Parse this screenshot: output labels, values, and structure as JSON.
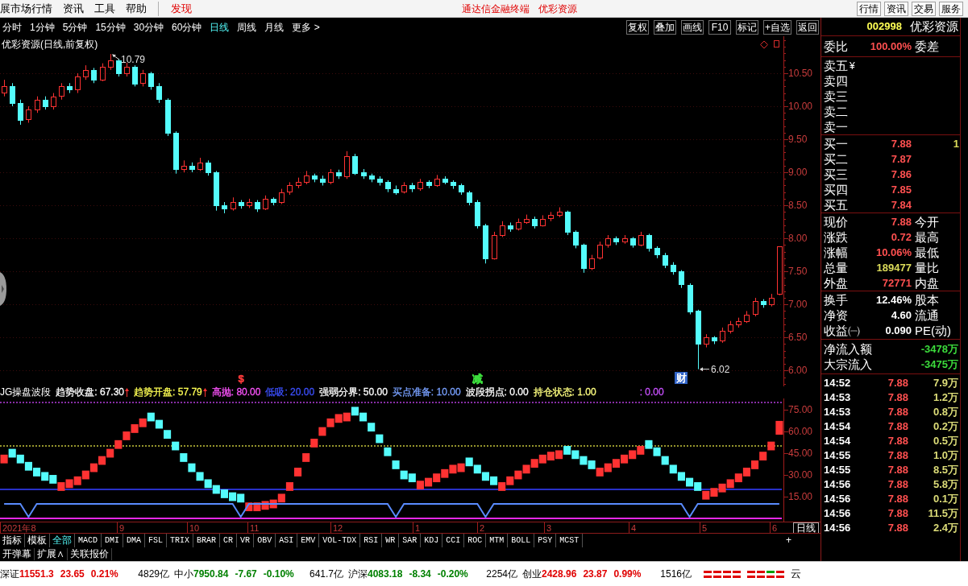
{
  "menu_bar": {
    "items": [
      {
        "label": "展市场行情",
        "kind": "menu"
      },
      {
        "label": "资讯",
        "kind": "menu"
      },
      {
        "label": "工具",
        "kind": "menu"
      },
      {
        "label": "帮助",
        "kind": "menu"
      },
      {
        "label": "发现",
        "kind": "highlight"
      }
    ],
    "title": "通达信金融终端",
    "subtitle": "优彩资源",
    "buttons": [
      "行情",
      "资讯",
      "交易",
      "服务"
    ]
  },
  "toolbar": {
    "periods": [
      {
        "label": "分时",
        "selected": false
      },
      {
        "label": "1分钟",
        "selected": false
      },
      {
        "label": "5分钟",
        "selected": false
      },
      {
        "label": "15分钟",
        "selected": false
      },
      {
        "label": "30分钟",
        "selected": false
      },
      {
        "label": "60分钟",
        "selected": false
      },
      {
        "label": "日线",
        "selected": true
      },
      {
        "label": "周线",
        "selected": false
      },
      {
        "label": "月线",
        "selected": false
      },
      {
        "label": "更多 >",
        "selected": false
      }
    ],
    "buttons": [
      "复权",
      "叠加",
      "画线",
      "F10",
      "标记",
      "+自选",
      "返回"
    ]
  },
  "price_chart": {
    "chart_data": [
      {
        "type": "candlestick",
        "title": "优彩资源(日线,前复权)",
        "ylim": [
          5.76,
          11.06
        ],
        "yticks": [
          {
            "value": 6,
            "label": "6.00"
          },
          {
            "value": 6.5,
            "label": "6.50"
          },
          {
            "value": 7,
            "label": "7.00"
          },
          {
            "value": 7.5,
            "label": "7.50"
          },
          {
            "value": 8,
            "label": "8.00"
          },
          {
            "value": 8.5,
            "label": "8.50"
          },
          {
            "value": 9,
            "label": "9.00"
          },
          {
            "value": 9.5,
            "label": "9.50"
          },
          {
            "value": 10,
            "label": "10.00"
          },
          {
            "value": 10.5,
            "label": "10.50"
          }
        ],
        "grid": true,
        "annotations": [
          "10.79",
          "6.02"
        ],
        "ohlc": [
          [
            10.2,
            10.4,
            10.15,
            10.3
          ],
          [
            10.3,
            10.35,
            10.0,
            10.05
          ],
          [
            10.05,
            10.1,
            9.72,
            9.8
          ],
          [
            9.8,
            10.0,
            9.75,
            9.95
          ],
          [
            9.95,
            10.15,
            9.9,
            10.1
          ],
          [
            10.1,
            10.15,
            9.95,
            10.0
          ],
          [
            10.0,
            10.2,
            9.95,
            10.15
          ],
          [
            10.15,
            10.35,
            10.1,
            10.3
          ],
          [
            10.3,
            10.35,
            10.2,
            10.25
          ],
          [
            10.25,
            10.5,
            10.2,
            10.45
          ],
          [
            10.45,
            10.62,
            10.4,
            10.55
          ],
          [
            10.55,
            10.58,
            10.35,
            10.4
          ],
          [
            10.4,
            10.65,
            10.38,
            10.6
          ],
          [
            10.6,
            10.79,
            10.55,
            10.7
          ],
          [
            10.7,
            10.72,
            10.45,
            10.5
          ],
          [
            10.5,
            10.66,
            10.45,
            10.6
          ],
          [
            10.6,
            10.62,
            10.3,
            10.35
          ],
          [
            10.35,
            10.55,
            10.3,
            10.5
          ],
          [
            10.5,
            10.52,
            10.25,
            10.3
          ],
          [
            10.3,
            10.35,
            10.05,
            10.1
          ],
          [
            10.1,
            10.12,
            9.55,
            9.6
          ],
          [
            9.6,
            9.62,
            8.98,
            9.05
          ],
          [
            9.05,
            9.18,
            9.0,
            9.1
          ],
          [
            9.1,
            9.15,
            9.0,
            9.05
          ],
          [
            9.05,
            9.22,
            9.02,
            9.15
          ],
          [
            9.15,
            9.18,
            8.95,
            9.0
          ],
          [
            9.0,
            9.02,
            8.42,
            8.5
          ],
          [
            8.5,
            8.55,
            8.38,
            8.45
          ],
          [
            8.45,
            8.62,
            8.42,
            8.55
          ],
          [
            8.55,
            8.58,
            8.45,
            8.5
          ],
          [
            8.5,
            8.6,
            8.46,
            8.55
          ],
          [
            8.55,
            8.58,
            8.4,
            8.45
          ],
          [
            8.45,
            8.65,
            8.43,
            8.6
          ],
          [
            8.6,
            8.62,
            8.5,
            8.55
          ],
          [
            8.55,
            8.75,
            8.52,
            8.7
          ],
          [
            8.7,
            8.85,
            8.66,
            8.8
          ],
          [
            8.8,
            8.92,
            8.76,
            8.85
          ],
          [
            8.85,
            9.02,
            8.82,
            8.95
          ],
          [
            8.95,
            8.98,
            8.85,
            8.9
          ],
          [
            8.9,
            8.95,
            8.8,
            8.85
          ],
          [
            8.85,
            9.05,
            8.82,
            9.0
          ],
          [
            9.0,
            9.04,
            8.9,
            8.95
          ],
          [
            8.95,
            9.32,
            8.9,
            9.25
          ],
          [
            9.25,
            9.28,
            8.96,
            9.0
          ],
          [
            9.0,
            9.05,
            8.9,
            8.95
          ],
          [
            8.95,
            8.98,
            8.85,
            8.9
          ],
          [
            8.9,
            8.94,
            8.8,
            8.85
          ],
          [
            8.85,
            8.88,
            8.7,
            8.75
          ],
          [
            8.75,
            8.8,
            8.66,
            8.7
          ],
          [
            8.7,
            8.85,
            8.68,
            8.8
          ],
          [
            8.8,
            8.84,
            8.7,
            8.75
          ],
          [
            8.75,
            8.9,
            8.72,
            8.85
          ],
          [
            8.85,
            8.88,
            8.76,
            8.8
          ],
          [
            8.8,
            8.96,
            8.78,
            8.9
          ],
          [
            8.9,
            8.94,
            8.82,
            8.85
          ],
          [
            8.85,
            8.88,
            8.75,
            8.8
          ],
          [
            8.8,
            8.83,
            8.66,
            8.7
          ],
          [
            8.7,
            8.72,
            8.5,
            8.55
          ],
          [
            8.55,
            8.58,
            8.15,
            8.2
          ],
          [
            8.2,
            8.22,
            7.62,
            7.7
          ],
          [
            7.7,
            8.1,
            7.68,
            8.05
          ],
          [
            8.05,
            8.26,
            8.02,
            8.2
          ],
          [
            8.2,
            8.24,
            8.1,
            8.15
          ],
          [
            8.15,
            8.3,
            8.12,
            8.25
          ],
          [
            8.25,
            8.36,
            8.22,
            8.3
          ],
          [
            8.3,
            8.33,
            8.15,
            8.2
          ],
          [
            8.2,
            8.35,
            8.18,
            8.3
          ],
          [
            8.3,
            8.4,
            8.26,
            8.35
          ],
          [
            8.35,
            8.47,
            8.32,
            8.4
          ],
          [
            8.4,
            8.42,
            8.05,
            8.1
          ],
          [
            8.1,
            8.12,
            7.85,
            7.9
          ],
          [
            7.9,
            7.92,
            7.48,
            7.55
          ],
          [
            7.55,
            7.75,
            7.52,
            7.7
          ],
          [
            7.7,
            7.95,
            7.68,
            7.9
          ],
          [
            7.9,
            8.05,
            7.86,
            8.0
          ],
          [
            8.0,
            8.03,
            7.9,
            7.95
          ],
          [
            7.95,
            8.05,
            7.92,
            8.0
          ],
          [
            8.0,
            8.02,
            7.86,
            7.9
          ],
          [
            7.9,
            8.1,
            7.88,
            8.05
          ],
          [
            8.05,
            8.07,
            7.8,
            7.85
          ],
          [
            7.85,
            7.88,
            7.7,
            7.75
          ],
          [
            7.75,
            7.78,
            7.55,
            7.6
          ],
          [
            7.6,
            7.64,
            7.45,
            7.5
          ],
          [
            7.5,
            7.52,
            7.25,
            7.3
          ],
          [
            7.3,
            7.32,
            6.85,
            6.9
          ],
          [
            6.9,
            6.92,
            6.02,
            6.4
          ],
          [
            6.4,
            6.55,
            6.35,
            6.5
          ],
          [
            6.5,
            6.52,
            6.4,
            6.45
          ],
          [
            6.45,
            6.65,
            6.42,
            6.6
          ],
          [
            6.6,
            6.75,
            6.56,
            6.7
          ],
          [
            6.7,
            6.8,
            6.65,
            6.75
          ],
          [
            6.75,
            6.9,
            6.72,
            6.85
          ],
          [
            6.85,
            7.1,
            6.82,
            7.05
          ],
          [
            7.05,
            7.08,
            6.95,
            7.0
          ],
          [
            7.0,
            7.16,
            6.97,
            7.1
          ],
          [
            7.16,
            7.88,
            7.14,
            7.88
          ]
        ]
      }
    ],
    "markers": [
      {
        "text": "$",
        "color": "#ff3c3c",
        "boxed": false
      },
      {
        "text": "减",
        "color": "#3cdc3c",
        "boxed": false
      },
      {
        "text": "财",
        "color": "#3264c8",
        "boxed": true
      }
    ]
  },
  "indicator": {
    "name": "JG操盘波段",
    "legend": [
      {
        "text": "趋势收盘: 67.30",
        "color": "#ffffff",
        "rising": true
      },
      {
        "text": "趋势开盘: 57.79",
        "color": "#ffff54",
        "rising": true
      },
      {
        "text": "高抛: 80.00",
        "color": "#ff54ff",
        "rising": false
      },
      {
        "text": "低吸: 20.00",
        "color": "#3c50ff",
        "rising": false
      },
      {
        "text": "强弱分界: 50.00",
        "color": "#ffffff",
        "rising": false
      },
      {
        "text": "买点准备: 10.00",
        "color": "#78a0ff",
        "rising": false
      },
      {
        "text": "波段拐点: 0.00",
        "color": "#ffffff",
        "rising": false
      },
      {
        "text": "持仓状态: 1.00",
        "color": "#ffff80",
        "rising": false
      },
      {
        "text": ": 0.00",
        "color": "#c850ff",
        "rising": false
      }
    ],
    "chart_data": [
      {
        "type": "bar",
        "ylim": [
          -2.2,
          82.8
        ],
        "yticks": [
          {
            "value": 15,
            "label": "15.00"
          },
          {
            "value": 30,
            "label": "30.00"
          },
          {
            "value": 45,
            "label": "45.00"
          },
          {
            "value": 60,
            "label": "60.00"
          },
          {
            "value": 75,
            "label": "75.00"
          }
        ],
        "base": [
          38,
          48,
          44,
          39,
          35,
          32,
          30,
          19,
          21,
          23,
          27,
          32,
          37,
          42,
          48,
          54,
          59,
          63,
          73,
          68,
          61,
          53,
          45,
          38,
          32,
          27,
          23,
          20,
          18,
          17,
          5,
          5,
          6,
          7,
          11,
          19,
          29,
          39,
          49,
          57,
          63,
          66,
          67,
          77,
          73,
          66,
          58,
          49,
          40,
          33,
          31,
          20,
          22,
          25,
          28,
          31,
          32,
          42,
          37,
          32,
          29,
          19,
          23,
          27,
          31,
          35,
          38,
          40,
          41,
          50,
          47,
          43,
          40,
          29,
          32,
          35,
          38,
          41,
          44,
          54,
          49,
          43,
          37,
          32,
          28,
          25,
          13,
          15,
          18,
          21,
          25,
          29,
          34,
          40,
          47,
          57.8
        ],
        "values": [
          6,
          -6,
          -6,
          -6,
          -6,
          -6,
          -6,
          6,
          6,
          6,
          6,
          6,
          6,
          6,
          6,
          6,
          6,
          6,
          -6,
          -6,
          -6,
          -6,
          -6,
          -6,
          -6,
          -6,
          -6,
          -6,
          -6,
          -6,
          6,
          6,
          6,
          6,
          6,
          6,
          6,
          6,
          6,
          6,
          6,
          6,
          6,
          -6,
          -6,
          -6,
          -6,
          -6,
          -6,
          -6,
          -6,
          6,
          6,
          6,
          6,
          6,
          6,
          -6,
          -6,
          -6,
          -6,
          6,
          6,
          6,
          6,
          6,
          6,
          6,
          6,
          -6,
          -6,
          -6,
          -6,
          6,
          6,
          6,
          6,
          6,
          6,
          -6,
          -6,
          -6,
          -6,
          -6,
          -6,
          -6,
          6,
          6,
          6,
          6,
          6,
          6,
          6,
          6,
          6,
          9.5
        ],
        "colors": [
          "#ff3232",
          "#54fcfc",
          "#54fcfc",
          "#54fcfc",
          "#54fcfc",
          "#54fcfc",
          "#54fcfc",
          "#ff3232",
          "#ff3232",
          "#ff3232",
          "#ff3232",
          "#ff3232",
          "#ff3232",
          "#ff3232",
          "#ff3232",
          "#ff3232",
          "#ff3232",
          "#ff3232",
          "#54fcfc",
          "#54fcfc",
          "#54fcfc",
          "#54fcfc",
          "#54fcfc",
          "#54fcfc",
          "#54fcfc",
          "#54fcfc",
          "#54fcfc",
          "#54fcfc",
          "#54fcfc",
          "#54fcfc",
          "#ff3232",
          "#ff3232",
          "#ff3232",
          "#ff3232",
          "#ff3232",
          "#ff3232",
          "#ff3232",
          "#ff3232",
          "#ff3232",
          "#ff3232",
          "#ff3232",
          "#ff3232",
          "#ff3232",
          "#54fcfc",
          "#54fcfc",
          "#54fcfc",
          "#54fcfc",
          "#54fcfc",
          "#54fcfc",
          "#54fcfc",
          "#54fcfc",
          "#ff3232",
          "#ff3232",
          "#ff3232",
          "#ff3232",
          "#ff3232",
          "#ff3232",
          "#54fcfc",
          "#54fcfc",
          "#54fcfc",
          "#54fcfc",
          "#ff3232",
          "#ff3232",
          "#ff3232",
          "#ff3232",
          "#ff3232",
          "#ff3232",
          "#ff3232",
          "#ff3232",
          "#54fcfc",
          "#54fcfc",
          "#54fcfc",
          "#54fcfc",
          "#ff3232",
          "#ff3232",
          "#ff3232",
          "#ff3232",
          "#ff3232",
          "#ff3232",
          "#54fcfc",
          "#54fcfc",
          "#54fcfc",
          "#54fcfc",
          "#54fcfc",
          "#54fcfc",
          "#54fcfc",
          "#ff3232",
          "#ff3232",
          "#ff3232",
          "#ff3232",
          "#ff3232",
          "#ff3232",
          "#ff3232",
          "#ff3232",
          "#ff3232",
          "#ff3232"
        ],
        "series": [
          {
            "type": "line",
            "color": "#5a8cff",
            "values": [
              10,
              10,
              10,
              1,
              10,
              10,
              10,
              10,
              10,
              10,
              10,
              10,
              10,
              10,
              10,
              10,
              10,
              10,
              10,
              10,
              10,
              10,
              10,
              10,
              10,
              10,
              10,
              10,
              10,
              1,
              10,
              10,
              10,
              10,
              10,
              10,
              10,
              10,
              10,
              10,
              10,
              10,
              10,
              10,
              10,
              10,
              10,
              10,
              1,
              10,
              10,
              10,
              10,
              10,
              10,
              10,
              10,
              10,
              10,
              1,
              10,
              10,
              10,
              10,
              10,
              10,
              10,
              10,
              10,
              10,
              10,
              10,
              10,
              10,
              10,
              10,
              10,
              10,
              10,
              10,
              10,
              10,
              10,
              10,
              1,
              10,
              10,
              10,
              10,
              10,
              10,
              10,
              10,
              10,
              10,
              10
            ]
          }
        ],
        "ref_lines": [
          {
            "axis": "y",
            "value": 80,
            "color": "#b43cdc",
            "line_style": "dotted"
          },
          {
            "axis": "y",
            "value": 50,
            "color": "#c8c83c",
            "line_style": "dotted"
          },
          {
            "axis": "y",
            "value": 20,
            "color": "#2830c8",
            "line_style": "solid"
          },
          {
            "axis": "y",
            "value": 0,
            "color": "#e628e6",
            "line_style": "solid"
          }
        ]
      }
    ],
    "time_axis": [
      "2021年8",
      "9",
      "10",
      "11",
      "12",
      "1",
      "2",
      "3",
      "4",
      "5",
      "6"
    ],
    "period_label": "日线"
  },
  "indicator_tabs": {
    "items": [
      {
        "label": "指标",
        "kind": "category",
        "selected": false
      },
      {
        "label": "模板",
        "kind": "category",
        "selected": false
      },
      {
        "label": "全部",
        "kind": "category",
        "selected": true
      },
      {
        "label": "MACD",
        "kind": "indicator",
        "selected": false
      },
      {
        "label": "DMI",
        "kind": "indicator",
        "selected": false
      },
      {
        "label": "DMA",
        "kind": "indicator",
        "selected": false
      },
      {
        "label": "FSL",
        "kind": "indicator",
        "selected": false
      },
      {
        "label": "TRIX",
        "kind": "indicator",
        "selected": false
      },
      {
        "label": "BRAR",
        "kind": "indicator",
        "selected": false
      },
      {
        "label": "CR",
        "kind": "indicator",
        "selected": false
      },
      {
        "label": "VR",
        "kind": "indicator",
        "selected": false
      },
      {
        "label": "OBV",
        "kind": "indicator",
        "selected": false
      },
      {
        "label": "ASI",
        "kind": "indicator",
        "selected": false
      },
      {
        "label": "EMV",
        "kind": "indicator",
        "selected": false
      },
      {
        "label": "VOL-TDX",
        "kind": "indicator",
        "selected": false
      },
      {
        "label": "RSI",
        "kind": "indicator",
        "selected": false
      },
      {
        "label": "WR",
        "kind": "indicator",
        "selected": false
      },
      {
        "label": "SAR",
        "kind": "indicator",
        "selected": false
      },
      {
        "label": "KDJ",
        "kind": "indicator",
        "selected": false
      },
      {
        "label": "CCI",
        "kind": "indicator",
        "selected": false
      },
      {
        "label": "ROC",
        "kind": "indicator",
        "selected": false
      },
      {
        "label": "MTM",
        "kind": "indicator",
        "selected": false
      },
      {
        "label": "BOLL",
        "kind": "indicator",
        "selected": false
      },
      {
        "label": "PSY",
        "kind": "indicator",
        "selected": false
      },
      {
        "label": "MCST",
        "kind": "indicator",
        "selected": false
      }
    ],
    "add": "+"
  },
  "extra_bar": {
    "items": [
      "开弹幕",
      "扩展∧",
      "关联报价"
    ]
  },
  "quote_panel": {
    "code": "002998",
    "name": "优彩资源",
    "ratio": {
      "label": "委比",
      "value": "100.00%",
      "label2": "委差"
    },
    "sell": [
      {
        "label": "卖五",
        "marker": "¥"
      },
      {
        "label": "卖四"
      },
      {
        "label": "卖三"
      },
      {
        "label": "卖二"
      },
      {
        "label": "卖一"
      }
    ],
    "buy": [
      {
        "label": "买一",
        "price": "7.88",
        "volume": "1"
      },
      {
        "label": "买二",
        "price": "7.87"
      },
      {
        "label": "买三",
        "price": "7.86"
      },
      {
        "label": "买四",
        "price": "7.85"
      },
      {
        "label": "买五",
        "price": "7.84"
      }
    ],
    "quotes": [
      {
        "label": "现价",
        "value": "7.88",
        "color": "#ff5050",
        "label2": "今开"
      },
      {
        "label": "涨跌",
        "value": "0.72",
        "color": "#ff5050",
        "label2": "最高"
      },
      {
        "label": "涨幅",
        "value": "10.06%",
        "color": "#ff5050",
        "label2": "最低"
      },
      {
        "label": "总量",
        "value": "189477",
        "color": "#dcdc5a",
        "label2": "量比"
      },
      {
        "label": "外盘",
        "value": "72771",
        "color": "#ff5050",
        "label2": "内盘"
      }
    ],
    "stats": [
      {
        "label": "换手",
        "value": "12.46%",
        "color": "#ffffff",
        "label2": "股本"
      },
      {
        "label": "净资",
        "value": "4.60",
        "color": "#ffffff",
        "label2": "流通"
      },
      {
        "label": "收益㈠",
        "value": "0.090",
        "color": "#ffffff",
        "label2": "PE(动)"
      }
    ],
    "flows": [
      {
        "label": "净流入额",
        "value": "-3478万"
      },
      {
        "label": "大宗流入",
        "value": "-3475万"
      }
    ],
    "ticks": [
      {
        "time": "14:52",
        "price": "7.88",
        "volume": "7.9万"
      },
      {
        "time": "14:53",
        "price": "7.88",
        "volume": "1.2万"
      },
      {
        "time": "14:53",
        "price": "7.88",
        "volume": "0.8万"
      },
      {
        "time": "14:54",
        "price": "7.88",
        "volume": "0.2万"
      },
      {
        "time": "14:54",
        "price": "7.88",
        "volume": "0.5万"
      },
      {
        "time": "14:55",
        "price": "7.88",
        "volume": "1.0万"
      },
      {
        "time": "14:55",
        "price": "7.88",
        "volume": "8.5万"
      },
      {
        "time": "14:56",
        "price": "7.88",
        "volume": "5.8万"
      },
      {
        "time": "14:56",
        "price": "7.88",
        "volume": "0.1万"
      },
      {
        "time": "14:56",
        "price": "7.88",
        "volume": "11.5万"
      },
      {
        "time": "14:56",
        "price": "7.88",
        "volume": "2.4万"
      }
    ]
  },
  "status_bar": {
    "indices": [
      {
        "name": "深证",
        "value": "11551.3",
        "change": "23.65",
        "percent": "0.21%",
        "amount": "4829亿",
        "color": "#e00000"
      },
      {
        "name": "中小",
        "value": "7950.84",
        "change": "-7.67",
        "percent": "-0.10%",
        "amount": "641.7亿",
        "color": "#008000"
      },
      {
        "name": "沪深",
        "value": "4083.18",
        "change": "-8.34",
        "percent": "-0.20%",
        "amount": "2254亿",
        "color": "#008000"
      },
      {
        "name": "创业",
        "value": "2428.96",
        "change": "23.87",
        "percent": "0.99%",
        "amount": "1516亿",
        "color": "#e00000"
      }
    ],
    "trailing_text": "云"
  }
}
